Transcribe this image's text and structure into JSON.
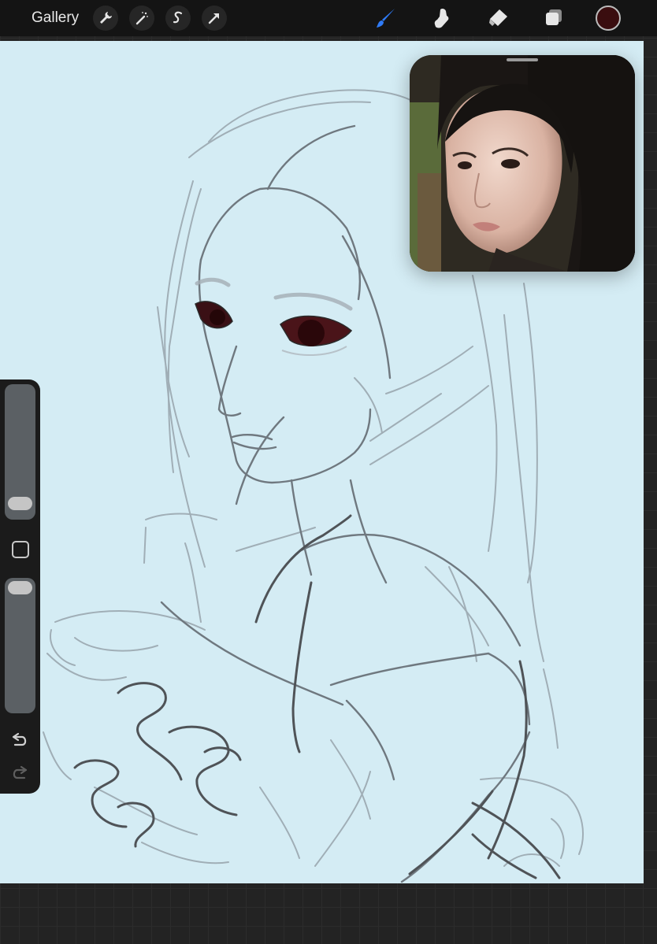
{
  "toolbar": {
    "gallery_label": "Gallery",
    "left_tools": [
      "wrench-icon",
      "magic-wand-icon",
      "selection-icon",
      "transform-arrow-icon"
    ],
    "right_tools": [
      "brush-icon",
      "smudge-icon",
      "eraser-icon",
      "layers-icon"
    ],
    "active_tool": "brush-icon",
    "current_color": "#3a0d0f",
    "accent_color": "#2f7bf6"
  },
  "reference_window": {
    "visible": true
  },
  "sidebar": {
    "brush_size_level": 0.1,
    "opacity_level": 0.95,
    "icons": [
      "modify-square-icon",
      "undo-icon",
      "redo-icon"
    ]
  }
}
